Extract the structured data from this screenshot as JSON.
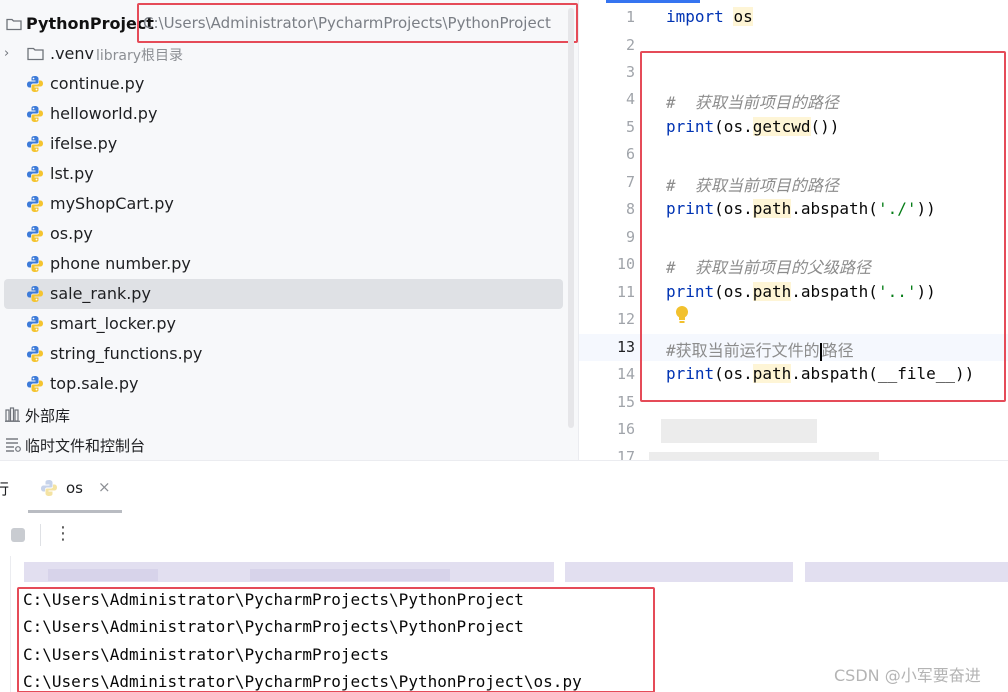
{
  "project_tree": {
    "root_name": "PythonProject",
    "root_path": "C:\\Users\\Administrator\\PycharmProjects\\PythonProject",
    "venv": {
      "label": ".venv",
      "hint": "library根目录"
    },
    "files": [
      "continue.py",
      "helloworld.py",
      "ifelse.py",
      "lst.py",
      "myShopCart.py",
      "os.py",
      "phone number.py",
      "sale_rank.py",
      "smart_locker.py",
      "string_functions.py",
      "top.sale.py"
    ],
    "selected_file": "sale_rank.py",
    "external_libraries": "外部库",
    "scratches": "临时文件和控制台"
  },
  "editor": {
    "line_numbers": [
      "1",
      "2",
      "3",
      "4",
      "5",
      "6",
      "7",
      "8",
      "9",
      "10",
      "11",
      "12",
      "13",
      "14",
      "15",
      "16",
      "17"
    ],
    "current_line": "13",
    "code": {
      "l1_kw": "import",
      "l1_mod": "os",
      "l4_comment": "#  获取当前项目的路径",
      "l5_print": "print",
      "l5_a": "(os.",
      "l5_fn": "getcwd",
      "l5_b": "())",
      "l7_comment": "#  获取当前项目的路径",
      "l8_print": "print",
      "l8_a": "(os.",
      "l8_path": "path",
      "l8_b": ".abspath(",
      "l8_str": "'./'",
      "l8_c": "))",
      "l10_comment": "#  获取当前项目的父级路径",
      "l11_print": "print",
      "l11_a": "(os.",
      "l11_path": "path",
      "l11_b": ".abspath(",
      "l11_str": "'..'",
      "l11_c": "))",
      "l13_comment_a": "#获取当前运行文件的",
      "l13_comment_b": "路径",
      "l14_print": "print",
      "l14_a": "(os.",
      "l14_path": "path",
      "l14_b": ".abspath(__file__))"
    }
  },
  "run_panel": {
    "title": "行",
    "tab_label": "os",
    "tab_close": "×",
    "more": "⋮",
    "output": [
      "C:\\Users\\Administrator\\PycharmProjects\\PythonProject",
      "C:\\Users\\Administrator\\PycharmProjects\\PythonProject",
      "C:\\Users\\Administrator\\PycharmProjects",
      "C:\\Users\\Administrator\\PycharmProjects\\PythonProject\\os.py"
    ]
  },
  "watermark": "CSDN @小军要奋进",
  "colors": {
    "highlight_box": "#e54b58",
    "keyword": "#0033b3",
    "string": "#067d17",
    "comment": "#8c8c8c",
    "accent": "#3574f0"
  },
  "icons": {
    "folder": "folder-icon",
    "python_file": "python-file-icon",
    "library": "library-icon",
    "scratches": "scratches-icon",
    "bulb": "intention-bulb-icon",
    "stop": "stop-icon"
  }
}
